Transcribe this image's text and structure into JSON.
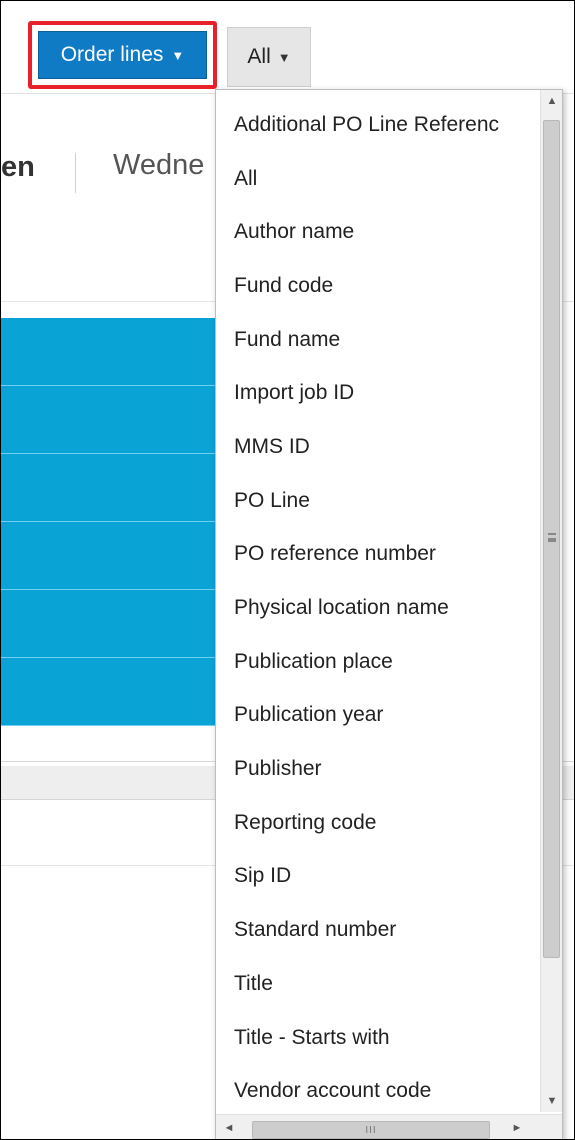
{
  "toolbar": {
    "order_lines_label": "Order lines",
    "order_lines_caret": "▼",
    "search_scope_label": "All",
    "search_scope_caret": "▼",
    "highlight_color": "#e8202a",
    "button_color": "#0f7bc4"
  },
  "background_page": {
    "title_fragment": "en",
    "date_fragment": "Wedne",
    "row_color": "#0aa3d6"
  },
  "dropdown": {
    "options": [
      "Additional PO Line Referenc",
      "All",
      "Author name",
      "Fund code",
      "Fund name",
      "Import job ID",
      "MMS ID",
      "PO Line",
      "PO reference number",
      "Physical location name",
      "Publication place",
      "Publication year",
      "Publisher",
      "Reporting code",
      "Sip ID",
      "Standard number",
      "Title",
      "Title - Starts with",
      "Vendor account code"
    ],
    "scroll_up_icon": "▲",
    "scroll_down_icon": "▼",
    "scroll_left_icon": "◄",
    "scroll_right_icon": "►",
    "h_thumb_grip": "III"
  }
}
